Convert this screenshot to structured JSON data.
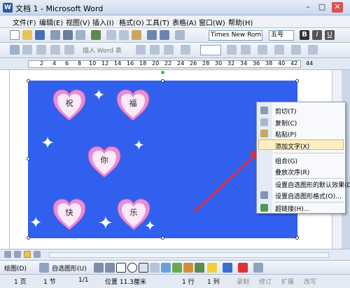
{
  "window": {
    "title": "文档 1 - Microsoft Word"
  },
  "menu": [
    "文件(F)",
    "编辑(E)",
    "视图(V)",
    "插入(I)",
    "格式(O)",
    "工具(T)",
    "表格(A)",
    "窗口(W)",
    "帮助(H)"
  ],
  "toolbar": {
    "font": "Times New Roman",
    "size": "五号",
    "insert_word_art": "插入 Word 表"
  },
  "ruler_numbers": [
    "2",
    "4",
    "6",
    "8",
    "10",
    "12",
    "14",
    "16",
    "18",
    "20",
    "22",
    "24",
    "26",
    "28",
    "30",
    "32",
    "34",
    "36",
    "38",
    "40",
    "42",
    "44"
  ],
  "hearts": [
    "祝",
    "福",
    "你",
    "快",
    "乐"
  ],
  "context_menu": {
    "items": [
      "剪切(T)",
      "复制(C)",
      "粘贴(P)",
      "添加文字(X)",
      "组合(G)",
      "叠放次序(R)",
      "设置自选图形的默认效果(D)",
      "设置自选图形格式(O)...",
      "超链接(H)..."
    ],
    "highlighted": "添加文字(X)"
  },
  "drawbar": {
    "draw": "绘图(D)",
    "autoshape": "自选图形(U)"
  },
  "status": {
    "page": "1 页",
    "section": "1 节",
    "pages": "1/1",
    "position": "位置 11.3厘米",
    "line": "1 行",
    "col": "1 列",
    "rec": "录制",
    "trk": "修订",
    "ext": "扩展",
    "ovr": "改写"
  },
  "colors": {
    "canvas": "#3160ee",
    "heart_top": "#e68fd8",
    "arrow": "#e0303a"
  }
}
